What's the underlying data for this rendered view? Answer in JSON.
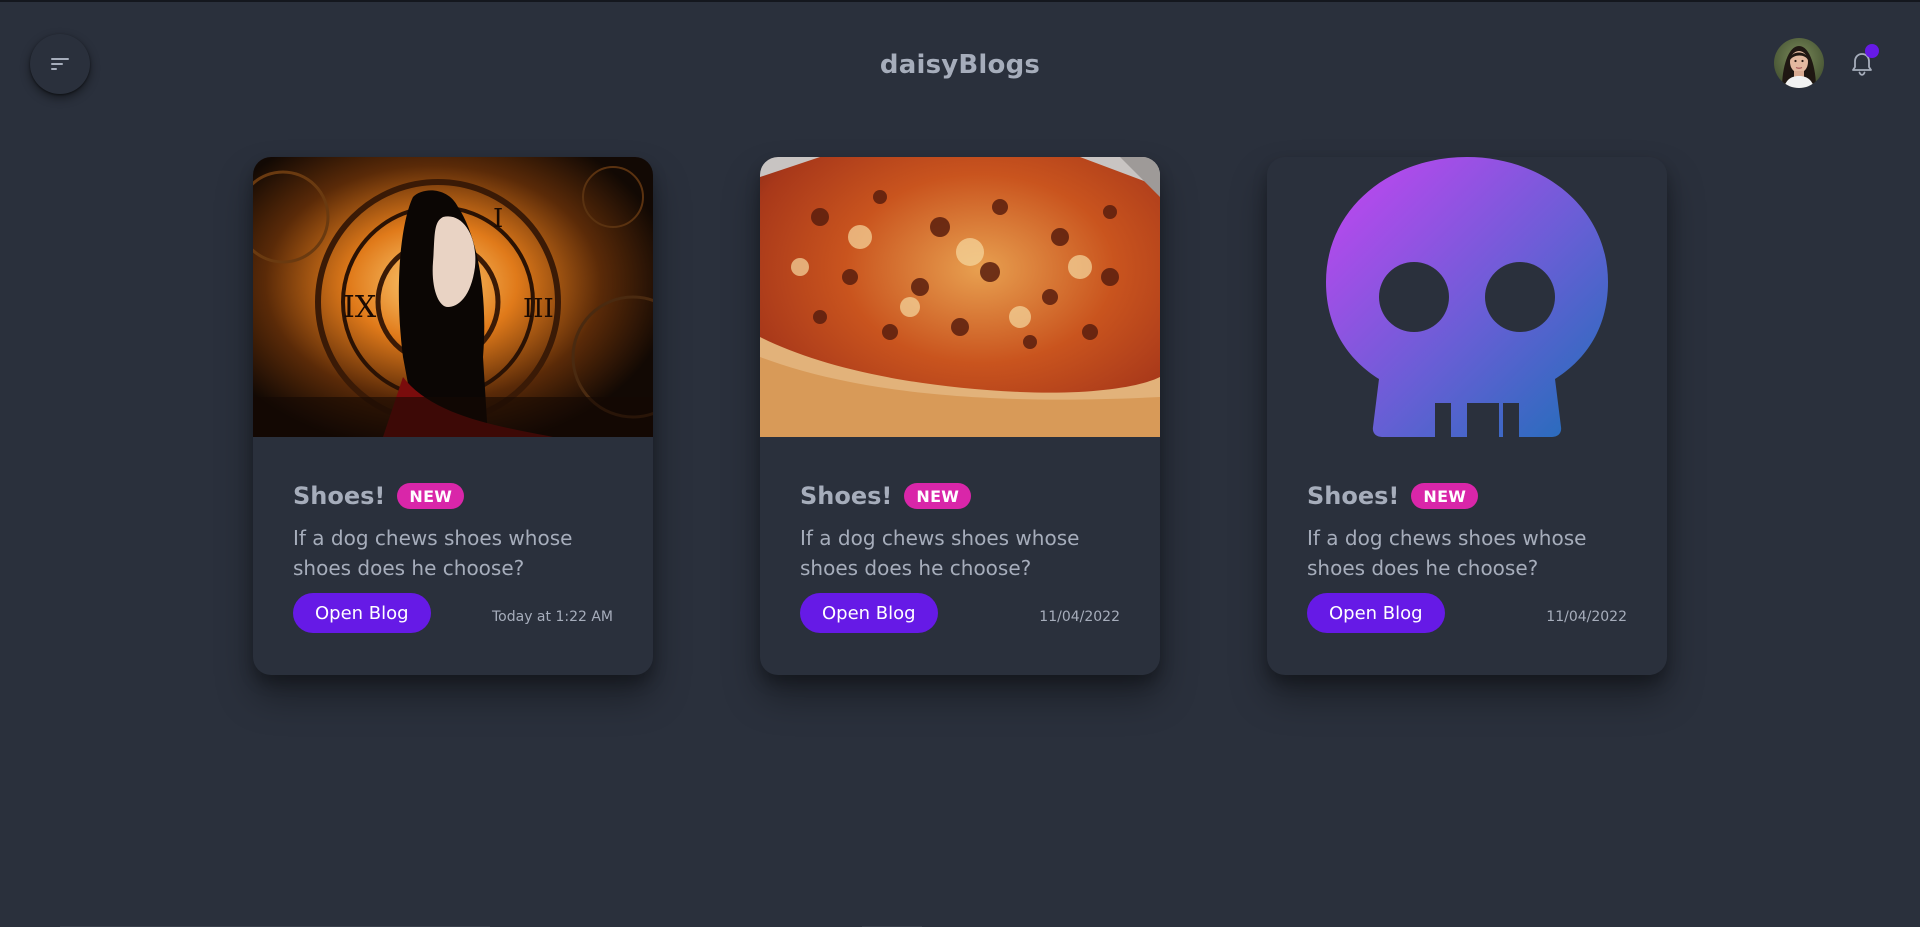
{
  "app": {
    "brand": "daisyBlogs"
  },
  "navbar": {
    "menu_icon": "menu-icon",
    "avatar_icon": "avatar-image",
    "notification_icon": "bell-icon",
    "notification_dot_color": "#661ae6"
  },
  "colors": {
    "background": "#2a303c",
    "primary": "#661ae6",
    "badge": "#d926a9",
    "text": "#a6adbb"
  },
  "cards": [
    {
      "image": "anime-girl-clock-image",
      "title": "Shoes!",
      "badge": "NEW",
      "description": "If a dog chews shoes whose shoes does he choose?",
      "button": "Open Blog",
      "date": "Today at 1:22 AM"
    },
    {
      "image": "pizza-image",
      "title": "Shoes!",
      "badge": "NEW",
      "description": "If a dog chews shoes whose shoes does he choose?",
      "button": "Open Blog",
      "date": "11/04/2022"
    },
    {
      "image": "skull-image",
      "title": "Shoes!",
      "badge": "NEW",
      "description": "If a dog chews shoes whose shoes does he choose?",
      "button": "Open Blog",
      "date": "11/04/2022"
    }
  ]
}
